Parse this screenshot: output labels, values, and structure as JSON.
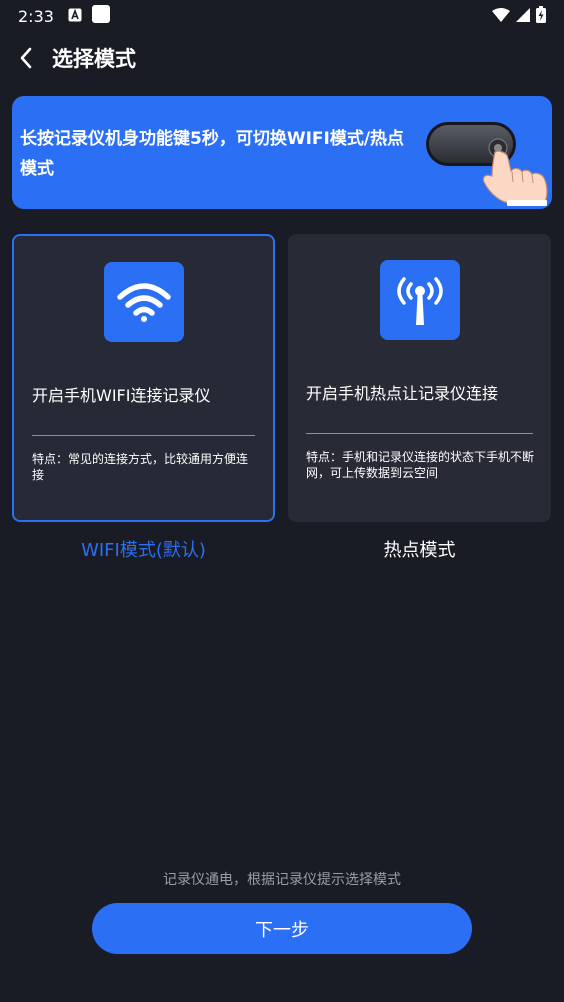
{
  "status_bar": {
    "time": "2:33"
  },
  "header": {
    "title": "选择模式"
  },
  "banner": {
    "text": "长按记录仪机身功能键5秒，可切换WIFI模式/热点模式"
  },
  "modes": [
    {
      "title": "开启手机WIFI连接记录仪",
      "desc": "特点：常见的连接方式，比较通用方便连接",
      "label": "WIFI模式(默认)",
      "selected": true
    },
    {
      "title": "开启手机热点让记录仪连接",
      "desc": "特点：手机和记录仪连接的状态下手机不断网，可上传数据到云空间",
      "label": "热点模式",
      "selected": false
    }
  ],
  "hint": "记录仪通电，根据记录仪提示选择模式",
  "next_button": "下一步",
  "colors": {
    "accent": "#2b6ff5",
    "background": "#1a1c25",
    "card": "#282a35"
  }
}
